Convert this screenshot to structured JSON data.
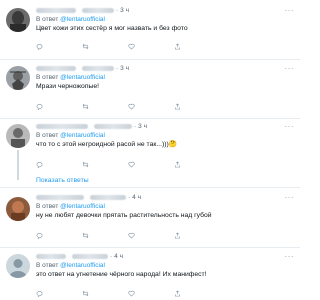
{
  "tweets": [
    {
      "time": "3 ч",
      "reply_prefix": "В ответ",
      "reply_handle": "@lentaruofficial",
      "text": "Цвет кожи этих сестёр я мог назвать и без фото"
    },
    {
      "time": "3 ч",
      "reply_prefix": "В ответ",
      "reply_handle": "@lentaruofficial",
      "text": "Мрази черножопые!"
    },
    {
      "time": "3 ч",
      "reply_prefix": "В ответ",
      "reply_handle": "@lentaruofficial",
      "text": "что то с этой негроидной расой не так...)))🤔"
    },
    {
      "time": "4 ч",
      "reply_prefix": "В ответ",
      "reply_handle": "@lentaruofficial",
      "text": "ну не любят девочки прятать растительность над губой"
    },
    {
      "time": "4 ч",
      "reply_prefix": "В ответ",
      "reply_handle": "@lentaruofficial",
      "text": "это ответ на угнетение чёрного народа! Их манифест!"
    }
  ],
  "show_replies": "Показать ответы",
  "more_glyph": "···",
  "dot": "·",
  "colors": {
    "accent": "#1d9bf0",
    "muted": "#536471",
    "border": "#e6ecf0"
  },
  "icons": [
    "reply-icon",
    "retweet-icon",
    "like-icon",
    "share-icon",
    "more-icon"
  ]
}
